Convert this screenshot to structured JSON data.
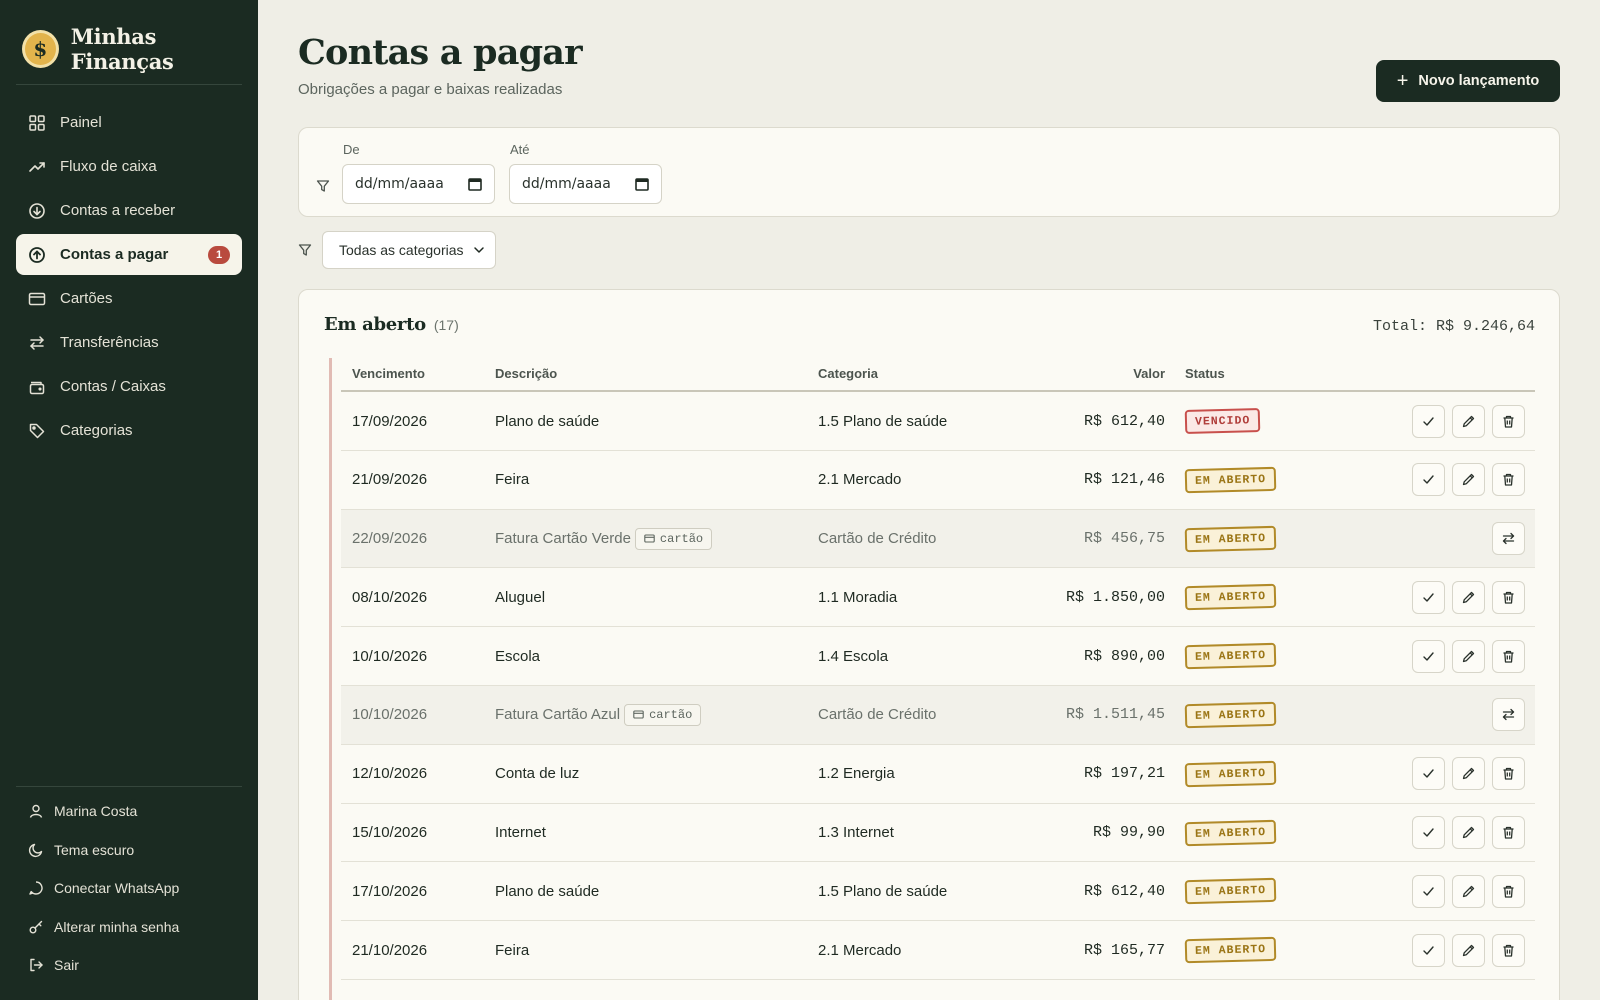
{
  "app": {
    "name": "Minhas Finanças",
    "logo_symbol": "$"
  },
  "sidebar": {
    "items": [
      {
        "label": "Painel",
        "icon": "grid-icon"
      },
      {
        "label": "Fluxo de caixa",
        "icon": "trend-icon"
      },
      {
        "label": "Contas a receber",
        "icon": "arrow-down-circle-icon"
      },
      {
        "label": "Contas a pagar",
        "icon": "arrow-up-circle-icon",
        "active": true,
        "badge": "1"
      },
      {
        "label": "Cartões",
        "icon": "credit-card-icon"
      },
      {
        "label": "Transferências",
        "icon": "transfer-icon"
      },
      {
        "label": "Contas / Caixas",
        "icon": "wallet-icon"
      },
      {
        "label": "Categorias",
        "icon": "tag-icon"
      }
    ],
    "bottom": {
      "user": "Marina Costa",
      "theme": "Tema escuro",
      "whatsapp": "Conectar WhatsApp",
      "password": "Alterar minha senha",
      "logout": "Sair"
    }
  },
  "header": {
    "title": "Contas a pagar",
    "subtitle": "Obrigações a pagar e baixas realizadas",
    "new_button": "Novo lançamento"
  },
  "filters": {
    "from_label": "De",
    "to_label": "Até",
    "date_placeholder": "dd/mm/aaaa",
    "category_select": "Todas as categorias"
  },
  "list": {
    "title": "Em aberto",
    "count": "(17)",
    "total": "Total: R$ 9.246,64",
    "columns": {
      "due": "Vencimento",
      "description": "Descrição",
      "category": "Categoria",
      "value": "Valor",
      "status": "Status"
    },
    "rows": [
      {
        "date": "17/09/2026",
        "desc": "Plano de saúde",
        "cat": "1.5 Plano de saúde",
        "value": "R$ 612,40",
        "status": "VENCIDO"
      },
      {
        "date": "21/09/2026",
        "desc": "Feira",
        "cat": "2.1 Mercado",
        "value": "R$ 121,46",
        "status": "EM ABERTO"
      },
      {
        "date": "22/09/2026",
        "desc": "Fatura Cartão Verde",
        "tag": "cartão",
        "cat": "Cartão de Crédito",
        "value": "R$ 456,75",
        "status": "EM ABERTO"
      },
      {
        "date": "08/10/2026",
        "desc": "Aluguel",
        "cat": "1.1 Moradia",
        "value": "R$ 1.850,00",
        "status": "EM ABERTO"
      },
      {
        "date": "10/10/2026",
        "desc": "Escola",
        "cat": "1.4 Escola",
        "value": "R$ 890,00",
        "status": "EM ABERTO"
      },
      {
        "date": "10/10/2026",
        "desc": "Fatura Cartão Azul",
        "tag": "cartão",
        "cat": "Cartão de Crédito",
        "value": "R$ 1.511,45",
        "status": "EM ABERTO"
      },
      {
        "date": "12/10/2026",
        "desc": "Conta de luz",
        "cat": "1.2 Energia",
        "value": "R$ 197,21",
        "status": "EM ABERTO"
      },
      {
        "date": "15/10/2026",
        "desc": "Internet",
        "cat": "1.3 Internet",
        "value": "R$ 99,90",
        "status": "EM ABERTO"
      },
      {
        "date": "17/10/2026",
        "desc": "Plano de saúde",
        "cat": "1.5 Plano de saúde",
        "value": "R$ 612,40",
        "status": "EM ABERTO"
      },
      {
        "date": "21/10/2026",
        "desc": "Feira",
        "cat": "2.1 Mercado",
        "value": "R$ 165,77",
        "status": "EM ABERTO"
      }
    ]
  },
  "colors": {
    "sidebar_bg": "#1b2b22",
    "page_bg": "#efeee6",
    "badge_open": "#b18a28",
    "badge_overdue": "#c8504c",
    "notification": "#b94a3e"
  }
}
